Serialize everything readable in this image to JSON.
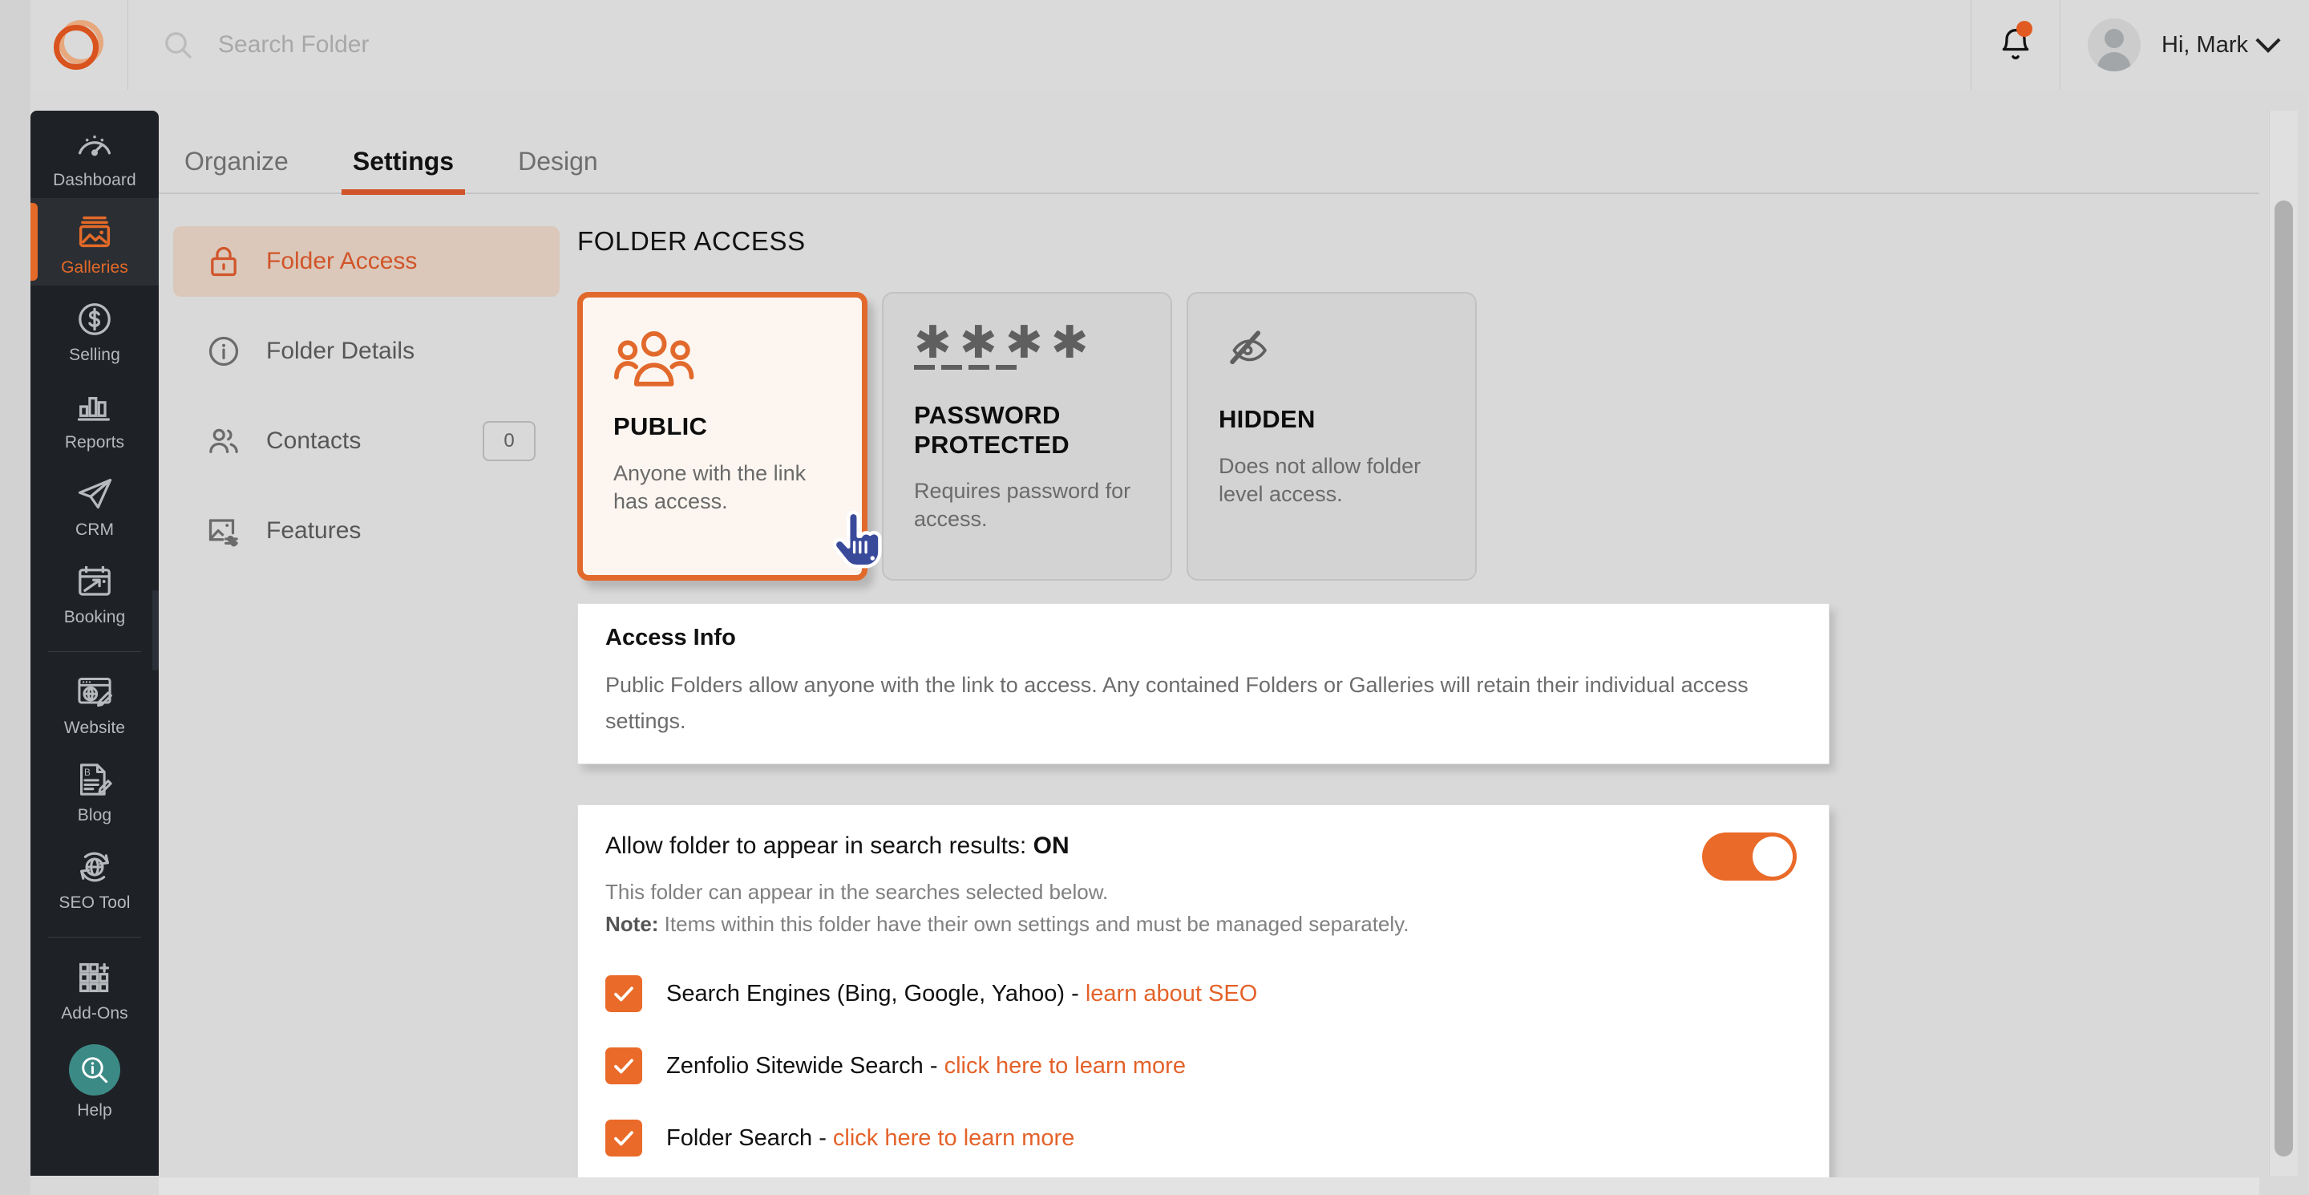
{
  "brand": {
    "accent": "#e2692c",
    "logo_name": "zenfolio-logo"
  },
  "header": {
    "search_placeholder": "Search Folder",
    "search_value": "",
    "user_greeting": "Hi, Mark"
  },
  "sidebar": {
    "items": [
      {
        "label": "Dashboard",
        "icon": "dashboard-icon",
        "active": false
      },
      {
        "label": "Galleries",
        "icon": "galleries-icon",
        "active": true
      },
      {
        "label": "Selling",
        "icon": "selling-icon",
        "active": false
      },
      {
        "label": "Reports",
        "icon": "reports-icon",
        "active": false
      },
      {
        "label": "CRM",
        "icon": "crm-icon",
        "active": false
      },
      {
        "label": "Booking",
        "icon": "booking-icon",
        "active": false
      },
      {
        "label": "Website",
        "icon": "website-icon",
        "active": false
      },
      {
        "label": "Blog",
        "icon": "blog-icon",
        "active": false
      },
      {
        "label": "SEO Tool",
        "icon": "seo-tool-icon",
        "active": false
      },
      {
        "label": "Add-Ons",
        "icon": "add-ons-icon",
        "active": false
      },
      {
        "label": "Help",
        "icon": "help-icon",
        "active": false
      }
    ]
  },
  "tabs": [
    {
      "label": "Organize",
      "active": false
    },
    {
      "label": "Settings",
      "active": true
    },
    {
      "label": "Design",
      "active": false
    }
  ],
  "settings_menu": [
    {
      "label": "Folder Access",
      "icon": "lock-icon",
      "active": true,
      "count": null
    },
    {
      "label": "Folder Details",
      "icon": "info-circle-icon",
      "active": false,
      "count": null
    },
    {
      "label": "Contacts",
      "icon": "contacts-icon",
      "active": false,
      "count": "0"
    },
    {
      "label": "Features",
      "icon": "features-icon",
      "active": false,
      "count": null
    }
  ],
  "panel": {
    "title": "FOLDER ACCESS",
    "cards": [
      {
        "title": "PUBLIC",
        "desc": "Anyone with the link has access.",
        "icon": "people-group-icon",
        "selected": true
      },
      {
        "title": "PASSWORD PROTECTED",
        "desc": "Requires password for access.",
        "icon": "asterisks-icon",
        "selected": false
      },
      {
        "title": "HIDDEN",
        "desc": "Does not allow folder level access.",
        "icon": "eye-slash-icon",
        "selected": false
      }
    ],
    "access_info": {
      "heading": "Access Info",
      "body": "Public Folders allow anyone with the link to access. Any contained Folders or Galleries will retain their individual access settings."
    },
    "search_settings": {
      "title_prefix": "Allow folder to appear in search results: ",
      "title_state": "ON",
      "toggle_on": true,
      "sub_line_1": "This folder can appear in the searches selected below.",
      "note_label": "Note:",
      "note_body": " Items within this folder have their own settings and must be managed separately.",
      "checkboxes": [
        {
          "text": "Search Engines (Bing, Google, Yahoo) - ",
          "link": "learn about SEO",
          "checked": true
        },
        {
          "text": "Zenfolio Sitewide Search - ",
          "link": "click here to learn more",
          "checked": true
        },
        {
          "text": "Folder Search - ",
          "link": "click here to learn more",
          "checked": true
        }
      ]
    }
  }
}
